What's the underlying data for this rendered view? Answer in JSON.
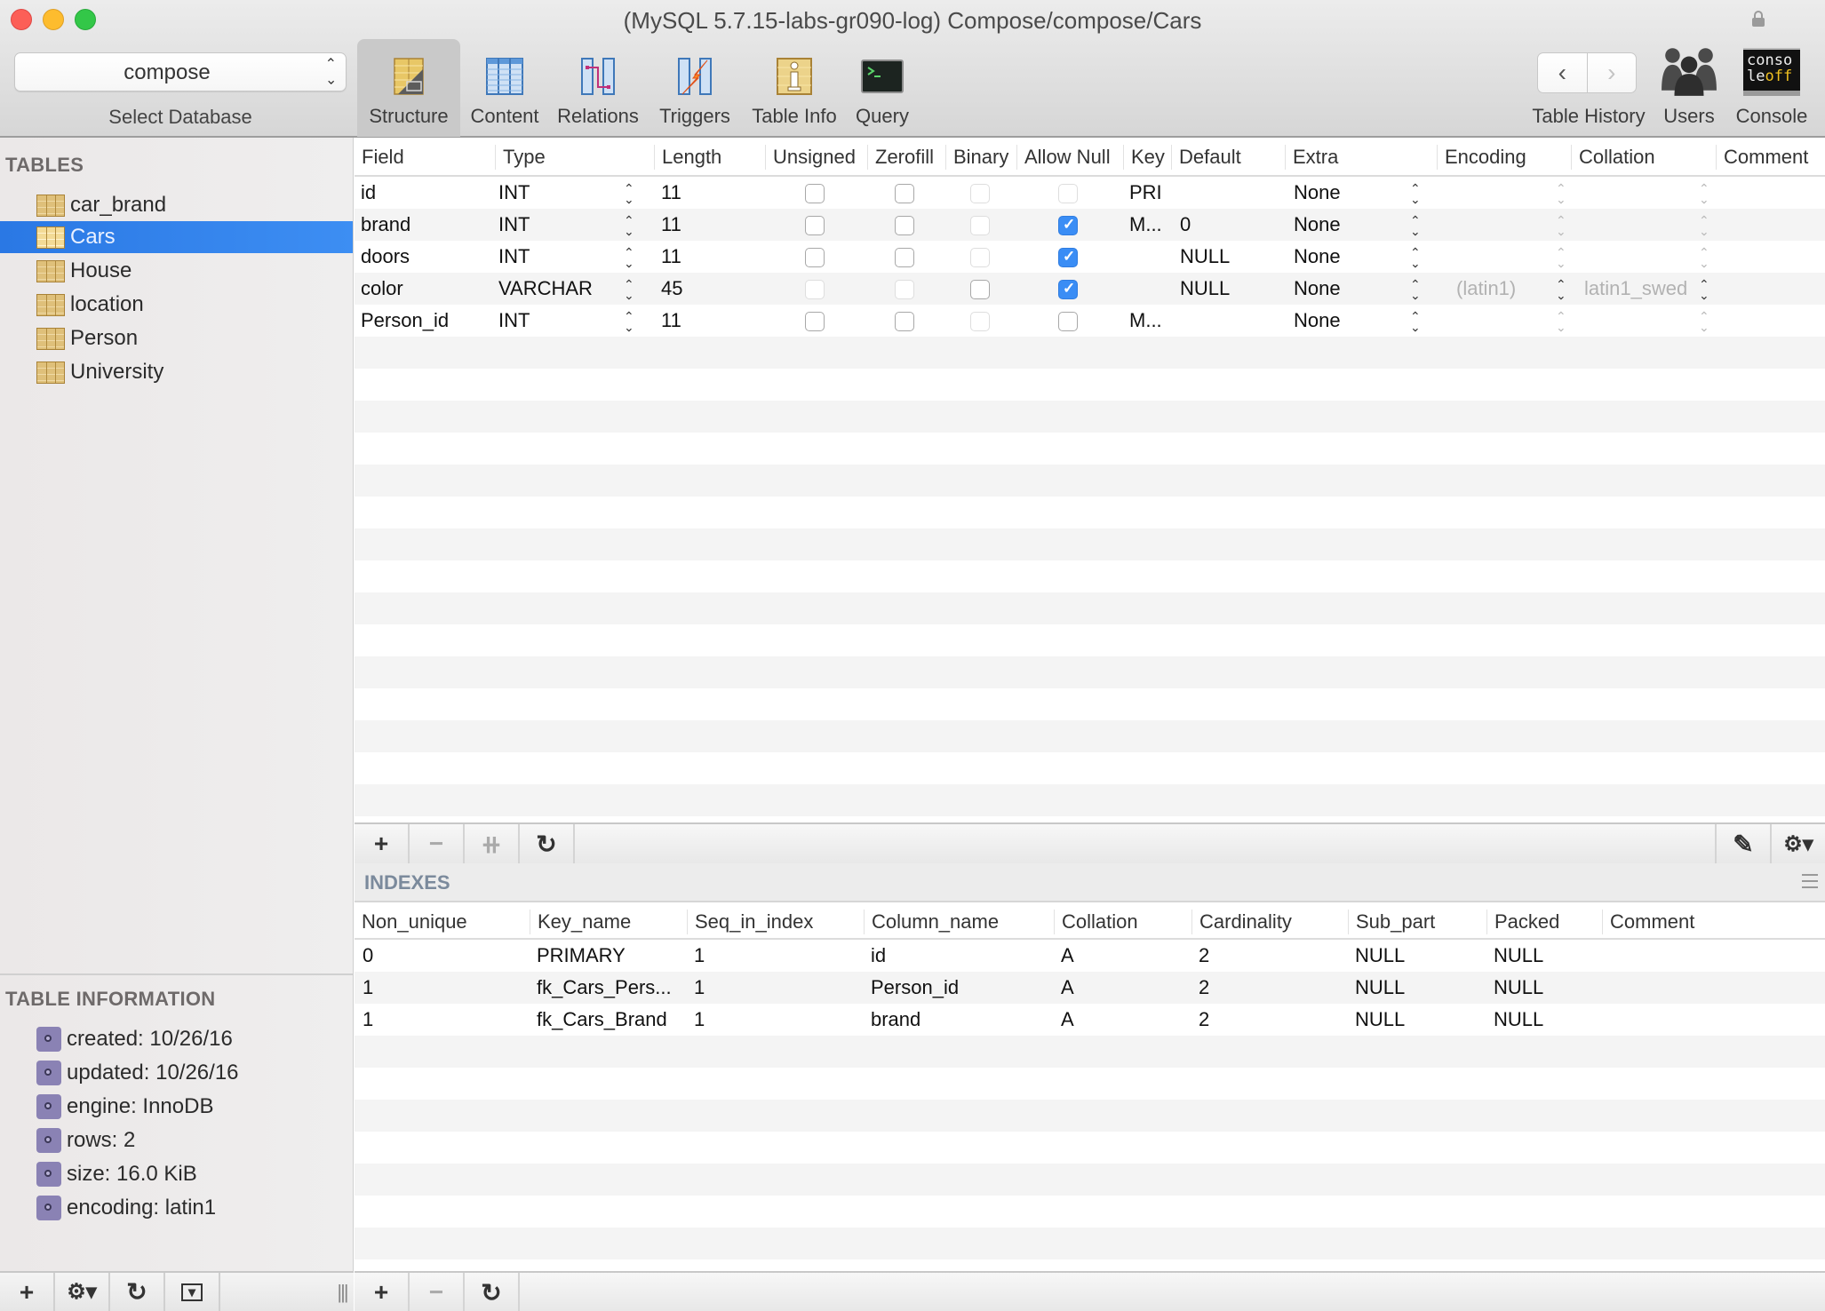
{
  "window": {
    "title": "(MySQL 5.7.15-labs-gr090-log) Compose/compose/Cars"
  },
  "toolbar": {
    "database_select": {
      "value": "compose",
      "label": "Select Database"
    },
    "tabs": [
      {
        "label": "Structure",
        "icon": "structure-icon",
        "active": true
      },
      {
        "label": "Content",
        "icon": "content-table-icon",
        "active": false
      },
      {
        "label": "Relations",
        "icon": "relations-icon",
        "active": false
      },
      {
        "label": "Triggers",
        "icon": "triggers-icon",
        "active": false
      },
      {
        "label": "Table Info",
        "icon": "table-info-icon",
        "active": false
      },
      {
        "label": "Query",
        "icon": "query-terminal-icon",
        "active": false
      }
    ],
    "history": {
      "label": "Table History",
      "back": "‹",
      "forward": "›"
    },
    "users": {
      "label": "Users"
    },
    "console": {
      "label": "Console",
      "icon_text_1": "conso",
      "icon_text_2": "le",
      "icon_text_3": "off"
    }
  },
  "sidebar": {
    "tables_title": "TABLES",
    "tables": [
      {
        "name": "car_brand",
        "selected": false
      },
      {
        "name": "Cars",
        "selected": true
      },
      {
        "name": "House",
        "selected": false
      },
      {
        "name": "location",
        "selected": false
      },
      {
        "name": "Person",
        "selected": false
      },
      {
        "name": "University",
        "selected": false
      }
    ],
    "info_title": "TABLE INFORMATION",
    "info": [
      "created: 10/26/16",
      "updated: 10/26/16",
      "engine: InnoDB",
      "rows: 2",
      "size: 16.0 KiB",
      "encoding: latin1"
    ],
    "bottom_buttons": {
      "add": "+",
      "gear": "⚙▾",
      "refresh": "↻",
      "filter": "▾",
      "grip": "|||"
    }
  },
  "structure": {
    "columns": [
      "Field",
      "Type",
      "Length",
      "Unsigned",
      "Zerofill",
      "Binary",
      "Allow Null",
      "Key",
      "Default",
      "Extra",
      "Encoding",
      "Collation",
      "Comment"
    ],
    "rows": [
      {
        "field": "id",
        "type": "INT",
        "length": "11",
        "unsigned": false,
        "zerofill": false,
        "binary": false,
        "binary_enabled": false,
        "allow_null": false,
        "allow_null_enabled": false,
        "unsigned_enabled": true,
        "zerofill_enabled": true,
        "key": "PRI",
        "default": "",
        "extra": "None",
        "encoding": "",
        "collation": "",
        "comment": ""
      },
      {
        "field": "brand",
        "type": "INT",
        "length": "11",
        "unsigned": false,
        "zerofill": false,
        "binary": false,
        "binary_enabled": false,
        "allow_null": true,
        "allow_null_enabled": true,
        "unsigned_enabled": true,
        "zerofill_enabled": true,
        "key": "M...",
        "default": "0",
        "extra": "None",
        "encoding": "",
        "collation": "",
        "comment": ""
      },
      {
        "field": "doors",
        "type": "INT",
        "length": "11",
        "unsigned": false,
        "zerofill": false,
        "binary": false,
        "binary_enabled": false,
        "allow_null": true,
        "allow_null_enabled": true,
        "unsigned_enabled": true,
        "zerofill_enabled": true,
        "key": "",
        "default": "NULL",
        "extra": "None",
        "encoding": "",
        "collation": "",
        "comment": ""
      },
      {
        "field": "color",
        "type": "VARCHAR",
        "length": "45",
        "unsigned": false,
        "zerofill": false,
        "binary": false,
        "binary_enabled": true,
        "allow_null": true,
        "allow_null_enabled": true,
        "unsigned_enabled": false,
        "zerofill_enabled": false,
        "key": "",
        "default": "NULL",
        "extra": "None",
        "encoding": "(latin1)",
        "collation": "latin1_swed",
        "comment": ""
      },
      {
        "field": "Person_id",
        "type": "INT",
        "length": "11",
        "unsigned": false,
        "zerofill": false,
        "binary": false,
        "binary_enabled": false,
        "allow_null": false,
        "allow_null_enabled": true,
        "unsigned_enabled": true,
        "zerofill_enabled": true,
        "key": "M...",
        "default": "",
        "extra": "None",
        "encoding": "",
        "collation": "",
        "comment": ""
      }
    ],
    "bottom_buttons": {
      "add": "+",
      "remove": "−",
      "duplicate": "⧺",
      "refresh": "↻",
      "edit": "✎",
      "gear": "⚙▾"
    }
  },
  "indexes": {
    "title": "INDEXES",
    "columns": [
      "Non_unique",
      "Key_name",
      "Seq_in_index",
      "Column_name",
      "Collation",
      "Cardinality",
      "Sub_part",
      "Packed",
      "Comment"
    ],
    "rows": [
      [
        "0",
        "PRIMARY",
        "1",
        "id",
        "A",
        "2",
        "NULL",
        "NULL",
        ""
      ],
      [
        "1",
        "fk_Cars_Pers...",
        "1",
        "Person_id",
        "A",
        "2",
        "NULL",
        "NULL",
        ""
      ],
      [
        "1",
        "fk_Cars_Brand",
        "1",
        "brand",
        "A",
        "2",
        "NULL",
        "NULL",
        ""
      ]
    ],
    "bottom_buttons": {
      "add": "+",
      "remove": "−",
      "refresh": "↻"
    }
  }
}
